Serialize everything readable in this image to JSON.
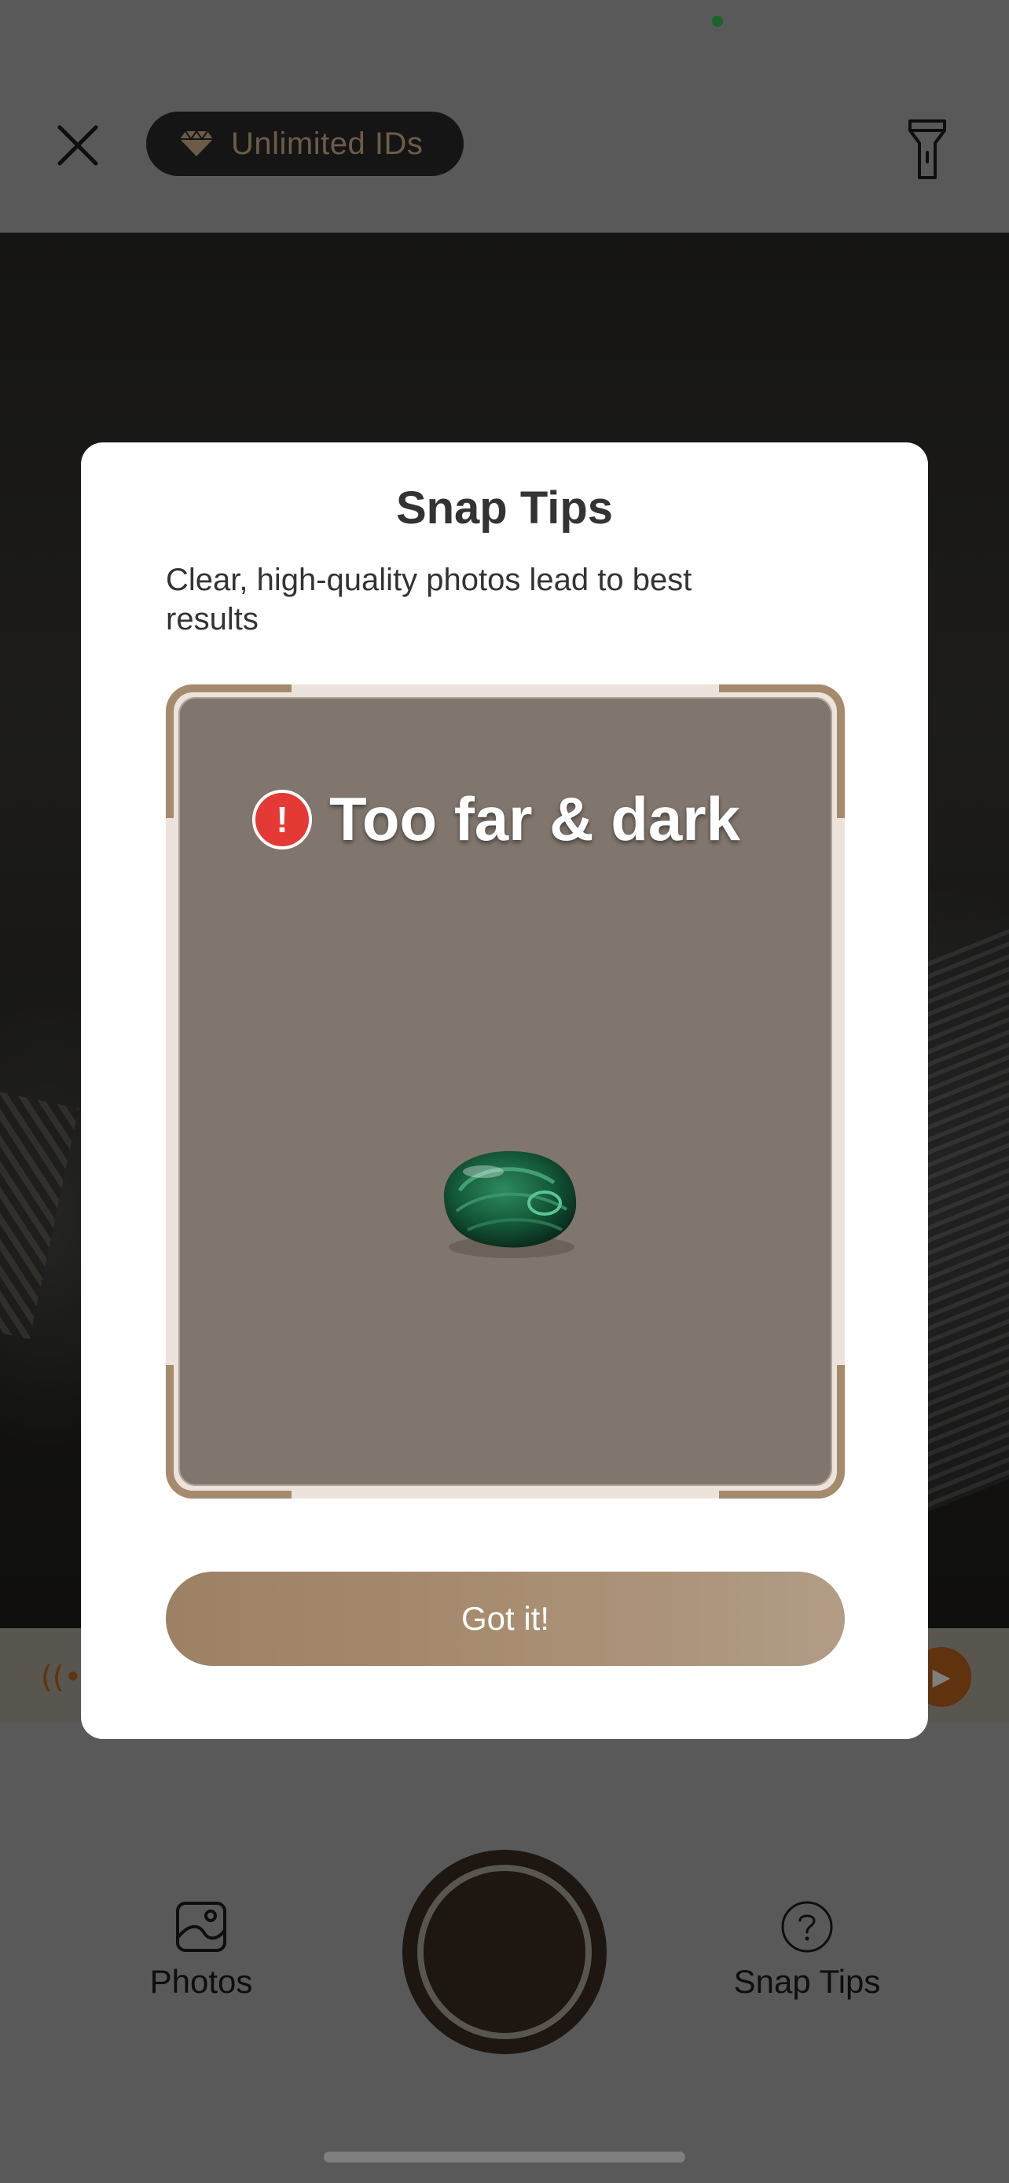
{
  "header": {
    "badge_label": "Unlimited IDs"
  },
  "bottom_bar": {
    "photos_label": "Photos",
    "snap_tips_label": "Snap Tips"
  },
  "modal": {
    "title": "Snap Tips",
    "subtitle": "Clear, high-quality photos lead to best results",
    "example": {
      "warning_text": "Too far & dark",
      "warning_icon": "exclamation-circle-icon"
    },
    "confirm_label": "Got it!"
  },
  "icons": {
    "close": "close-icon",
    "badge": "diamond-icon",
    "flash": "flashlight-icon",
    "photos": "photo-gallery-icon",
    "snap_tips": "question-circle-icon",
    "banner": "signal-icon",
    "banner_go": "play-arrow-icon"
  },
  "colors": {
    "accent": "#a58a6d",
    "badge_text": "#d9b98f",
    "warning": "#e53935",
    "status_dot": "#34c759"
  }
}
